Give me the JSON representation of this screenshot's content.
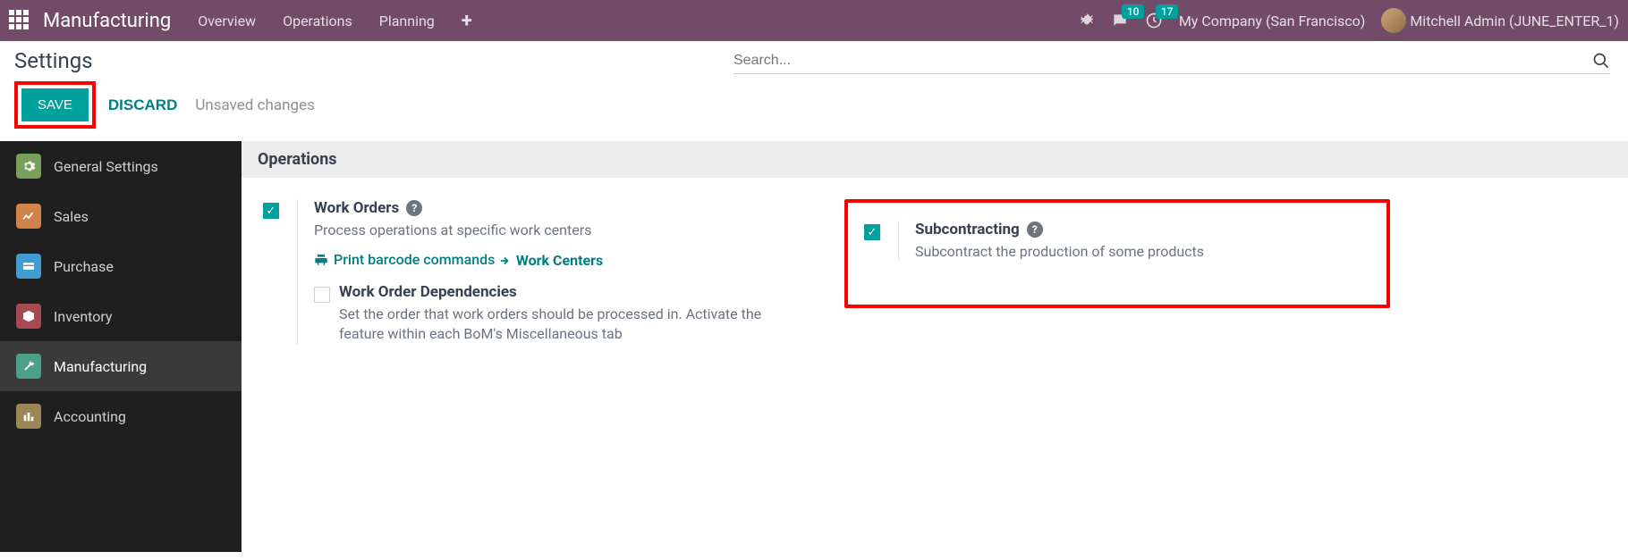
{
  "topbar": {
    "brand": "Manufacturing",
    "menu": [
      "Overview",
      "Operations",
      "Planning"
    ],
    "messages_badge": "10",
    "activities_badge": "17",
    "company": "My Company (San Francisco)",
    "user": "Mitchell Admin (JUNE_ENTER_1)"
  },
  "page": {
    "title": "Settings",
    "search_placeholder": "Search...",
    "save": "SAVE",
    "discard": "DISCARD",
    "status": "Unsaved changes"
  },
  "sidebar": {
    "items": [
      {
        "label": "General Settings"
      },
      {
        "label": "Sales"
      },
      {
        "label": "Purchase"
      },
      {
        "label": "Inventory"
      },
      {
        "label": "Manufacturing"
      },
      {
        "label": "Accounting"
      }
    ]
  },
  "section": {
    "title": "Operations"
  },
  "settings": {
    "work_orders": {
      "title": "Work Orders",
      "desc": "Process operations at specific work centers",
      "link_print": "Print barcode commands",
      "link_centers": "Work Centers",
      "dep_title": "Work Order Dependencies",
      "dep_desc": "Set the order that work orders should be processed in. Activate the feature within each BoM's Miscellaneous tab"
    },
    "subcontracting": {
      "title": "Subcontracting",
      "desc": "Subcontract the production of some products"
    }
  }
}
